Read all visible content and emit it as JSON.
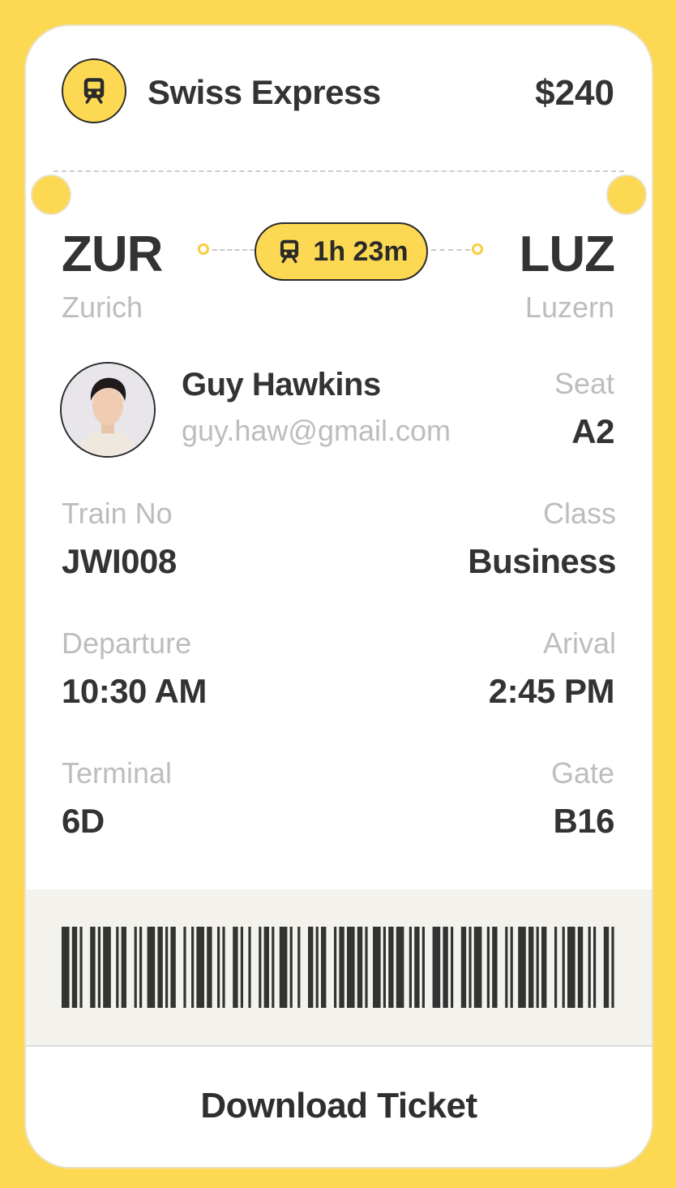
{
  "header": {
    "brand": "Swiss Express",
    "price": "$240",
    "icon": "train-icon"
  },
  "route": {
    "from_code": "ZUR",
    "from_city": "Zurich",
    "to_code": "LUZ",
    "to_city": "Luzern",
    "duration": "1h 23m"
  },
  "passenger": {
    "name": "Guy Hawkins",
    "email": "guy.haw@gmail.com",
    "seat_label": "Seat",
    "seat": "A2"
  },
  "details": {
    "train_no_label": "Train No",
    "train_no": "JWI008",
    "class_label": "Class",
    "class": "Business",
    "departure_label": "Departure",
    "departure": "10:30 AM",
    "arrival_label": "Arival",
    "arrival": "2:45 PM",
    "terminal_label": "Terminal",
    "terminal": "6D",
    "gate_label": "Gate",
    "gate": "B16"
  },
  "actions": {
    "download": "Download Ticket"
  },
  "colors": {
    "accent": "#FDD853",
    "text": "#333333",
    "muted": "#BDBDBD",
    "barcode_bg": "#F3F2EC"
  }
}
